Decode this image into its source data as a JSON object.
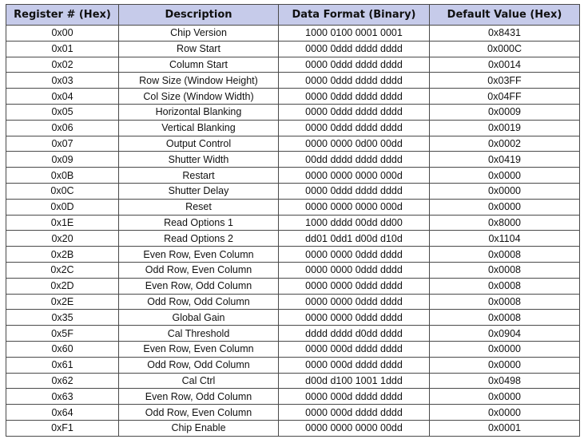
{
  "table": {
    "headers": [
      "Register # (Hex)",
      "Description",
      "Data Format (Binary)",
      "Default Value (Hex)"
    ],
    "header_bg": "#c6cbea",
    "rows": [
      [
        "0x00",
        "Chip Version",
        "1000 0100 0001 0001",
        "0x8431"
      ],
      [
        "0x01",
        "Row Start",
        "0000 0ddd dddd dddd",
        "0x000C"
      ],
      [
        "0x02",
        "Column Start",
        "0000 0ddd dddd dddd",
        "0x0014"
      ],
      [
        "0x03",
        "Row Size (Window Height)",
        "0000 0ddd dddd dddd",
        "0x03FF"
      ],
      [
        "0x04",
        "Col Size (Window Width)",
        "0000 0ddd dddd dddd",
        "0x04FF"
      ],
      [
        "0x05",
        "Horizontal Blanking",
        "0000 0ddd dddd dddd",
        "0x0009"
      ],
      [
        "0x06",
        "Vertical Blanking",
        "0000 0ddd dddd dddd",
        "0x0019"
      ],
      [
        "0x07",
        "Output Control",
        "0000 0000 0d00 00dd",
        "0x0002"
      ],
      [
        "0x09",
        "Shutter Width",
        "00dd dddd dddd dddd",
        "0x0419"
      ],
      [
        "0x0B",
        "Restart",
        "0000 0000 0000 000d",
        "0x0000"
      ],
      [
        "0x0C",
        "Shutter Delay",
        "0000 0ddd dddd dddd",
        "0x0000"
      ],
      [
        "0x0D",
        "Reset",
        "0000 0000 0000 000d",
        "0x0000"
      ],
      [
        "0x1E",
        "Read Options 1",
        "1000 dddd 00dd dd00",
        "0x8000"
      ],
      [
        "0x20",
        "Read Options 2",
        "dd01 0dd1 d00d d10d",
        "0x1104"
      ],
      [
        "0x2B",
        "Even Row, Even Column",
        "0000 0000 0ddd dddd",
        "0x0008"
      ],
      [
        "0x2C",
        "Odd Row, Even Column",
        "0000 0000 0ddd dddd",
        "0x0008"
      ],
      [
        "0x2D",
        "Even Row, Odd Column",
        "0000 0000 0ddd dddd",
        "0x0008"
      ],
      [
        "0x2E",
        "Odd Row, Odd Column",
        "0000 0000 0ddd dddd",
        "0x0008"
      ],
      [
        "0x35",
        "Global Gain",
        "0000 0000 0ddd dddd",
        "0x0008"
      ],
      [
        "0x5F",
        "Cal Threshold",
        "dddd dddd d0dd dddd",
        "0x0904"
      ],
      [
        "0x60",
        "Even Row, Even Column",
        "0000 000d dddd dddd",
        "0x0000"
      ],
      [
        "0x61",
        "Odd Row, Odd Column",
        "0000 000d dddd dddd",
        "0x0000"
      ],
      [
        "0x62",
        "Cal Ctrl",
        "d00d d100 1001 1ddd",
        "0x0498"
      ],
      [
        "0x63",
        "Even Row, Odd Column",
        "0000 000d dddd dddd",
        "0x0000"
      ],
      [
        "0x64",
        "Odd Row, Even Column",
        "0000 000d dddd dddd",
        "0x0000"
      ],
      [
        "0xF1",
        "Chip Enable",
        "0000 0000 0000 00dd",
        "0x0001"
      ]
    ]
  }
}
